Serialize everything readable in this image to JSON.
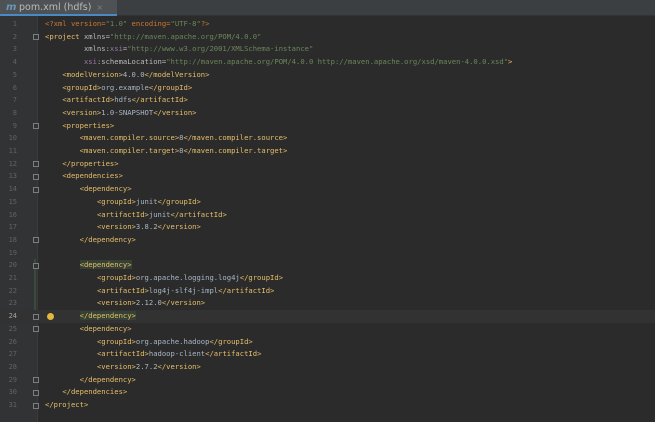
{
  "tabs": [
    {
      "icon": "maven-icon",
      "label": "pom.xml (hdfs)",
      "close": "×"
    }
  ],
  "editor": {
    "current_line": 24,
    "lines": [
      {
        "n": "1",
        "segs": [
          {
            "c": "pi",
            "t": "<?xml version="
          },
          {
            "c": "val",
            "t": "\"1.0\""
          },
          {
            "c": "pi",
            "t": " encoding="
          },
          {
            "c": "val",
            "t": "\"UTF-8\""
          },
          {
            "c": "pi",
            "t": "?>"
          }
        ]
      },
      {
        "n": "2",
        "segs": [
          {
            "c": "tag",
            "t": "<project "
          },
          {
            "c": "attr",
            "t": "xmlns="
          },
          {
            "c": "val",
            "t": "\"http://maven.apache.org/POM/4.0.0\""
          }
        ]
      },
      {
        "n": "3",
        "segs": [
          {
            "c": "txt",
            "t": "         "
          },
          {
            "c": "attr",
            "t": "xmlns:"
          },
          {
            "c": "ns",
            "t": "xsi"
          },
          {
            "c": "attr",
            "t": "="
          },
          {
            "c": "val",
            "t": "\"http://www.w3.org/2001/XMLSchema-instance\""
          }
        ]
      },
      {
        "n": "4",
        "segs": [
          {
            "c": "txt",
            "t": "         "
          },
          {
            "c": "ns",
            "t": "xsi"
          },
          {
            "c": "attr",
            "t": ":schemaLocation="
          },
          {
            "c": "val",
            "t": "\"http://maven.apache.org/POM/4.0.0 http://maven.apache.org/xsd/maven-4.0.0.xsd\""
          },
          {
            "c": "tag",
            "t": ">"
          }
        ]
      },
      {
        "n": "5",
        "segs": [
          {
            "c": "txt",
            "t": "    "
          },
          {
            "c": "tag",
            "t": "<modelVersion>"
          },
          {
            "c": "txt",
            "t": "4.0.0"
          },
          {
            "c": "tag",
            "t": "</modelVersion>"
          }
        ]
      },
      {
        "n": "6",
        "segs": [
          {
            "c": "txt",
            "t": "    "
          },
          {
            "c": "tag",
            "t": "<groupId>"
          },
          {
            "c": "txt",
            "t": "org.example"
          },
          {
            "c": "tag",
            "t": "</groupId>"
          }
        ]
      },
      {
        "n": "7",
        "segs": [
          {
            "c": "txt",
            "t": "    "
          },
          {
            "c": "tag",
            "t": "<artifactId>"
          },
          {
            "c": "txt",
            "t": "hdfs"
          },
          {
            "c": "tag",
            "t": "</artifactId>"
          }
        ]
      },
      {
        "n": "8",
        "segs": [
          {
            "c": "txt",
            "t": "    "
          },
          {
            "c": "tag",
            "t": "<version>"
          },
          {
            "c": "txt",
            "t": "1.0-SNAPSHOT"
          },
          {
            "c": "tag",
            "t": "</version>"
          }
        ]
      },
      {
        "n": "9",
        "segs": [
          {
            "c": "txt",
            "t": "    "
          },
          {
            "c": "tag",
            "t": "<properties>"
          }
        ]
      },
      {
        "n": "10",
        "segs": [
          {
            "c": "txt",
            "t": "        "
          },
          {
            "c": "tag",
            "t": "<maven.compiler.source>"
          },
          {
            "c": "txt",
            "t": "8"
          },
          {
            "c": "tag",
            "t": "</maven.compiler.source>"
          }
        ]
      },
      {
        "n": "11",
        "segs": [
          {
            "c": "txt",
            "t": "        "
          },
          {
            "c": "tag",
            "t": "<maven.compiler.target>"
          },
          {
            "c": "txt",
            "t": "8"
          },
          {
            "c": "tag",
            "t": "</maven.compiler.target>"
          }
        ]
      },
      {
        "n": "12",
        "segs": [
          {
            "c": "txt",
            "t": "    "
          },
          {
            "c": "tag",
            "t": "</properties>"
          }
        ]
      },
      {
        "n": "13",
        "segs": [
          {
            "c": "txt",
            "t": "    "
          },
          {
            "c": "tag",
            "t": "<dependencies>"
          }
        ]
      },
      {
        "n": "14",
        "segs": [
          {
            "c": "txt",
            "t": "        "
          },
          {
            "c": "tag",
            "t": "<dependency>"
          }
        ]
      },
      {
        "n": "15",
        "segs": [
          {
            "c": "txt",
            "t": "            "
          },
          {
            "c": "tag",
            "t": "<groupId>"
          },
          {
            "c": "txt",
            "t": "junit"
          },
          {
            "c": "tag",
            "t": "</groupId>"
          }
        ]
      },
      {
        "n": "16",
        "segs": [
          {
            "c": "txt",
            "t": "            "
          },
          {
            "c": "tag",
            "t": "<artifactId>"
          },
          {
            "c": "txt",
            "t": "junit"
          },
          {
            "c": "tag",
            "t": "</artifactId>"
          }
        ]
      },
      {
        "n": "17",
        "segs": [
          {
            "c": "txt",
            "t": "            "
          },
          {
            "c": "tag",
            "t": "<version>"
          },
          {
            "c": "txt",
            "t": "3.8.2"
          },
          {
            "c": "tag",
            "t": "</version>"
          }
        ]
      },
      {
        "n": "18",
        "segs": [
          {
            "c": "txt",
            "t": "        "
          },
          {
            "c": "tag",
            "t": "</dependency>"
          }
        ]
      },
      {
        "n": "19",
        "segs": []
      },
      {
        "n": "20",
        "segs": [
          {
            "c": "txt",
            "t": "        "
          },
          {
            "c": "tag hl",
            "t": "<dependency>"
          }
        ]
      },
      {
        "n": "21",
        "segs": [
          {
            "c": "txt",
            "t": "            "
          },
          {
            "c": "tag",
            "t": "<groupId>"
          },
          {
            "c": "txt",
            "t": "org.apache.logging.log4j"
          },
          {
            "c": "tag",
            "t": "</groupId>"
          }
        ]
      },
      {
        "n": "22",
        "segs": [
          {
            "c": "txt",
            "t": "            "
          },
          {
            "c": "tag",
            "t": "<artifactId>"
          },
          {
            "c": "txt",
            "t": "log4j-slf4j-impl"
          },
          {
            "c": "tag",
            "t": "</artifactId>"
          }
        ]
      },
      {
        "n": "23",
        "segs": [
          {
            "c": "txt",
            "t": "            "
          },
          {
            "c": "tag",
            "t": "<version>"
          },
          {
            "c": "txt",
            "t": "2.12.0"
          },
          {
            "c": "tag",
            "t": "</version>"
          }
        ]
      },
      {
        "n": "24",
        "segs": [
          {
            "c": "txt",
            "t": "        "
          },
          {
            "c": "tag hl",
            "t": "</dependency>"
          }
        ]
      },
      {
        "n": "25",
        "segs": [
          {
            "c": "txt",
            "t": "        "
          },
          {
            "c": "tag",
            "t": "<dependency>"
          }
        ]
      },
      {
        "n": "26",
        "segs": [
          {
            "c": "txt",
            "t": "            "
          },
          {
            "c": "tag",
            "t": "<groupId>"
          },
          {
            "c": "txt",
            "t": "org.apache.hadoop"
          },
          {
            "c": "tag",
            "t": "</groupId>"
          }
        ]
      },
      {
        "n": "27",
        "segs": [
          {
            "c": "txt",
            "t": "            "
          },
          {
            "c": "tag",
            "t": "<artifactId>"
          },
          {
            "c": "txt",
            "t": "hadoop-client"
          },
          {
            "c": "tag",
            "t": "</artifactId>"
          }
        ]
      },
      {
        "n": "28",
        "segs": [
          {
            "c": "txt",
            "t": "            "
          },
          {
            "c": "tag",
            "t": "<version>"
          },
          {
            "c": "txt",
            "t": "2.7.2"
          },
          {
            "c": "tag",
            "t": "</version>"
          }
        ]
      },
      {
        "n": "29",
        "segs": [
          {
            "c": "txt",
            "t": "        "
          },
          {
            "c": "tag",
            "t": "</dependency>"
          }
        ]
      },
      {
        "n": "30",
        "segs": [
          {
            "c": "txt",
            "t": "    "
          },
          {
            "c": "tag",
            "t": "</dependencies>"
          }
        ]
      },
      {
        "n": "31",
        "segs": [
          {
            "c": "tag",
            "t": "</project>"
          }
        ]
      }
    ]
  },
  "gutter": {
    "fold_markers": [
      2,
      9,
      12,
      13,
      14,
      18,
      20,
      24,
      25,
      29,
      30,
      31
    ],
    "intention_bulb": 24,
    "vcs_changed": [
      20,
      21,
      22,
      23,
      24
    ]
  },
  "colors": {
    "background": "#2b2b2b",
    "gutter": "#313335",
    "tag": "#e8bf6a",
    "string": "#6a8759",
    "text": "#a9b7c6",
    "attribute": "#bababa",
    "namespace": "#9876aa",
    "prolog": "#cc7832",
    "line_number": "#606366",
    "current_line": "#323232",
    "tag_match": "#344134",
    "accent": "#4a88c7"
  }
}
